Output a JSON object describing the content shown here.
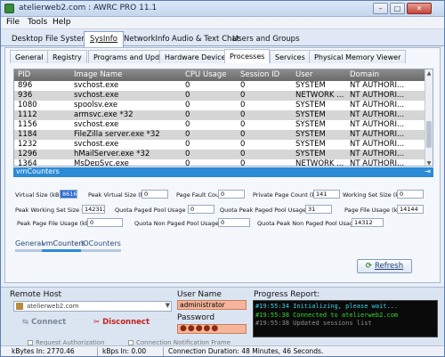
{
  "window": {
    "title": "atelierweb2.com : AWRC PRO 11.1",
    "minimize": "–",
    "maximize": "□",
    "close": "✕"
  },
  "menu": [
    "File",
    "Tools",
    "Help"
  ],
  "main_tabs": [
    "Desktop",
    "File System",
    "SysInfo",
    "NetworkInfo",
    "Audio & Text Chat",
    "Users and Groups"
  ],
  "sub_tabs": [
    "General",
    "Registry",
    "Programs and Updates",
    "Hardware Devices",
    "Processes",
    "Services",
    "Physical Memory Viewer"
  ],
  "process_table": {
    "columns": [
      "PID",
      "Image Name",
      "CPU Usage",
      "Session ID",
      "User",
      "Domain"
    ],
    "rows": [
      [
        "896",
        "svchost.exe",
        "0",
        "0",
        "SYSTEM",
        "NT AUTHORI..."
      ],
      [
        "936",
        "svchost.exe",
        "0",
        "0",
        "NETWORK ...",
        "NT AUTHORI..."
      ],
      [
        "1080",
        "spoolsv.exe",
        "0",
        "0",
        "SYSTEM",
        "NT AUTHORI..."
      ],
      [
        "1112",
        "armsvc.exe *32",
        "0",
        "0",
        "SYSTEM",
        "NT AUTHORI..."
      ],
      [
        "1156",
        "svchost.exe",
        "0",
        "0",
        "SYSTEM",
        "NT AUTHORI..."
      ],
      [
        "1184",
        "FileZilla server.exe *32",
        "0",
        "0",
        "SYSTEM",
        "NT AUTHORI..."
      ],
      [
        "1232",
        "svchost.exe",
        "0",
        "0",
        "SYSTEM",
        "NT AUTHORI..."
      ],
      [
        "1296",
        "hMailServer.exe *32",
        "0",
        "0",
        "SYSTEM",
        "NT AUTHORI..."
      ],
      [
        "1364",
        "MsDepSvc.exe",
        "0",
        "0",
        "NETWORK ...",
        "NT AUTHORI..."
      ]
    ]
  },
  "vmcounters": {
    "title": "vmCounters",
    "pin": "⇥",
    "fields": [
      {
        "label": "Virtual Size (kB):",
        "value": "86160"
      },
      {
        "label": "Peak Virtual Size (kB):",
        "value": "0"
      },
      {
        "label": "Page Fault Count:",
        "value": "0"
      },
      {
        "label": "Private Page Count (kB):",
        "value": "141"
      },
      {
        "label": "Working Set Size (kB):",
        "value": "0"
      },
      {
        "label": "Peak Working Set Size (kB):",
        "value": "142312"
      },
      {
        "label": "Quota Paged Pool Usage (kB):",
        "value": "0"
      },
      {
        "label": "Quota Peak Paged Pool Usage(kB):",
        "value": "31"
      },
      {
        "label": "Page File Usage (kB):",
        "value": "14144"
      },
      {
        "label": "Peak Page File Usage (kB):",
        "value": "0"
      },
      {
        "label": "Quota Non Paged Pool Usage (kB):",
        "value": "0"
      },
      {
        "label": "Quota Peak Non Paged Pool Usage(kB):",
        "value": "14312"
      }
    ]
  },
  "bottom_tabs": [
    "General",
    "vmCounters",
    "IOCounters"
  ],
  "refresh_label": "Refresh",
  "remote_host": {
    "title": "Remote Host",
    "value": "atelierweb2.com",
    "connect": "Connect",
    "disconnect": "Disconnect"
  },
  "credentials": {
    "user_label": "User Name",
    "user_value": "administrator",
    "password_label": "Password",
    "password_mask": "●●●●●"
  },
  "progress": {
    "title": "Progress Report:",
    "lines": [
      "#19:55:34 Initializing, please wait...",
      "#19:55:38 Connected to atelierweb2.com",
      "#19:55:38 Updated sessions list"
    ]
  },
  "hidden_options": [
    "Request Authorization",
    "Connection Notification Frame"
  ],
  "status": {
    "kbytes_in": "kBytes In: 2770.46",
    "kbps_in": "kBps In: 0.00",
    "duration": "Connection Duration: 48 Minutes, 46 Seconds."
  },
  "colors": {
    "accent": "#2b8bd6",
    "header_gray": "#7a7a7a",
    "credential_field": "#f5b59a",
    "report_bg": "#0a0a0a"
  }
}
